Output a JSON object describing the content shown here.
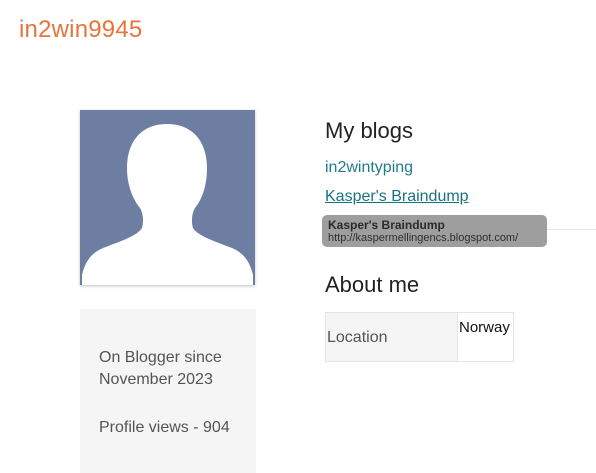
{
  "profile": {
    "username": "in2win9945"
  },
  "avatar": {
    "icon": "default-user-silhouette-icon",
    "background_color": "#6e7ea3"
  },
  "info": {
    "since": "On Blogger since November 2023",
    "views": "Profile views - 904"
  },
  "blogs": {
    "title": "My blogs",
    "items": [
      {
        "label": "in2wintyping"
      },
      {
        "label": "Kasper's Braindump"
      }
    ],
    "tooltip": {
      "title": "Kasper's Braindump",
      "url": "http://kaspermellingencs.blogspot.com/"
    }
  },
  "about": {
    "title": "About me",
    "rows": [
      {
        "label": "Location",
        "value": "Norway"
      }
    ]
  },
  "colors": {
    "username": "#e8743b",
    "link": "#1f7c8c",
    "card_background": "#f5f5f5"
  }
}
